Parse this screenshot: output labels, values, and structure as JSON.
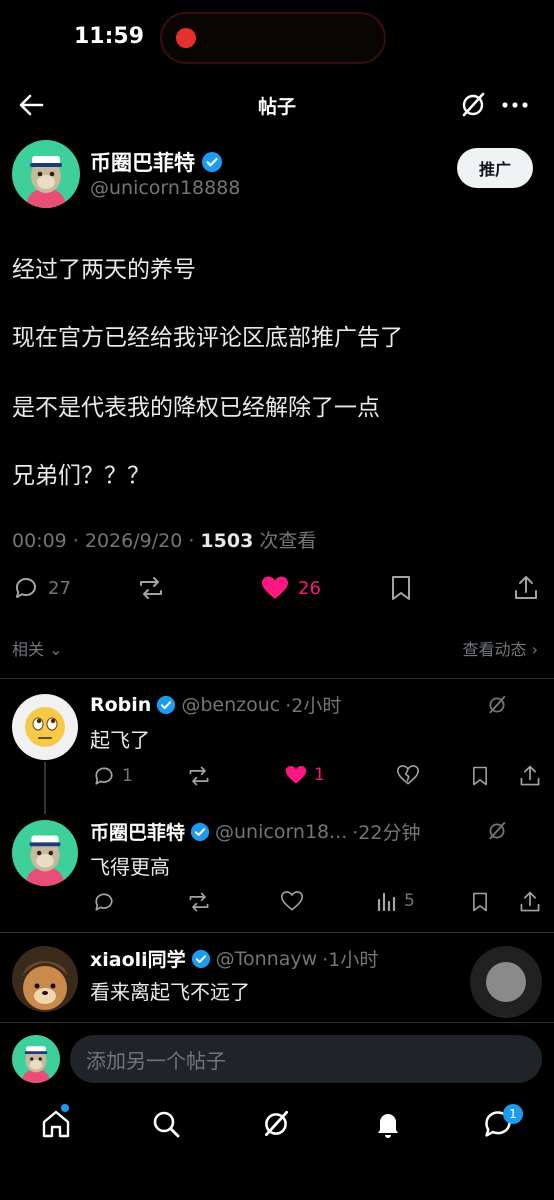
{
  "status": {
    "time": "11:59"
  },
  "nav": {
    "title": "帖子"
  },
  "post": {
    "author_name": "币圈巴菲特",
    "author_handle": "@unicorn18888",
    "promote_label": "推广",
    "lines": [
      "经过了两天的养号",
      "现在官方已经给我评论区底部推广告了",
      "是不是代表我的降权已经解除了一点",
      "兄弟们？？？"
    ],
    "meta_time": "00:09 · 2026/9/20 · ",
    "meta_views": "1503",
    "meta_views_label": " 次查看",
    "replies_count": "27",
    "likes_count": "26"
  },
  "related": {
    "label": "相关",
    "view_activity": "查看动态"
  },
  "replies": [
    {
      "name": "Robin",
      "handle": "@benzouc",
      "time": "·2小时",
      "text": "起飞了",
      "comment_count": "1",
      "like_count": "1"
    },
    {
      "name": "币圈巴菲特",
      "handle": "@unicorn18...",
      "time": "·22分钟",
      "text": "飞得更高",
      "view_count": "5"
    },
    {
      "name": "xiaoli同学",
      "handle": "@Tonnayw",
      "time": "·1小时",
      "text": "看来离起飞不远了"
    }
  ],
  "composer": {
    "placeholder": "添加另一个帖子"
  },
  "tabbar": {
    "messages_badge": "1"
  },
  "colors": {
    "accent": "#1d9bf0",
    "like": "#f91880",
    "muted": "#71767b"
  }
}
